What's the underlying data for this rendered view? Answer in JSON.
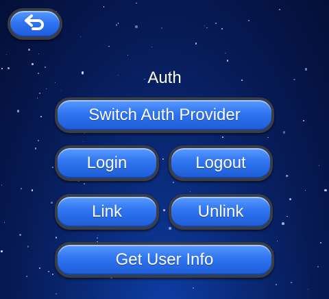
{
  "header": {
    "back_icon": "back-arrow-icon"
  },
  "auth": {
    "title": "Auth",
    "switch_provider_label": "Switch Auth Provider",
    "login_label": "Login",
    "logout_label": "Logout",
    "link_label": "Link",
    "unlink_label": "Unlink",
    "get_user_info_label": "Get User Info"
  },
  "colors": {
    "button_blue": "#2f74f0",
    "button_border": "#3a3d44",
    "background": "#071a55"
  }
}
